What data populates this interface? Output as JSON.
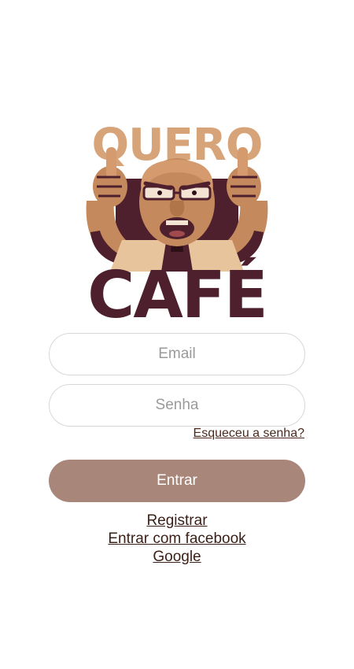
{
  "logo": {
    "line1": "QUERO",
    "line2": "CAFÉ"
  },
  "form": {
    "email_placeholder": "Email",
    "password_placeholder": "Senha",
    "forgot_label": "Esqueceu a senha?",
    "login_label": "Entrar"
  },
  "links": {
    "register": "Registrar",
    "facebook": "Entrar com facebook",
    "google": "Google"
  },
  "colors": {
    "primary_button": "#a8877a",
    "link_text": "#3a1f17",
    "logo_tan": "#d7a47a",
    "logo_dark": "#4e1f2c"
  }
}
